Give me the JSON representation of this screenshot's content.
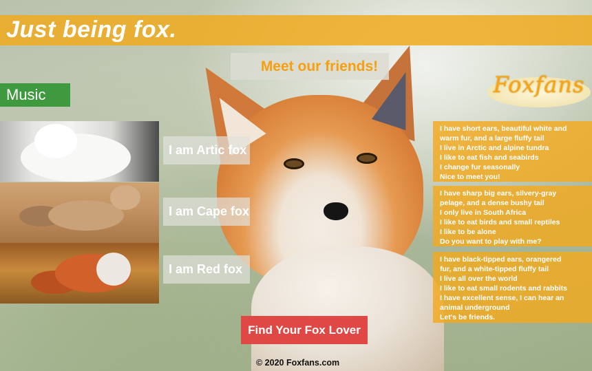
{
  "header": {
    "title": "Just being fox."
  },
  "meet_label": "Meet our friends!",
  "music_label": "Music",
  "logo": {
    "text": "Foxfans"
  },
  "friends": [
    {
      "button_label": "I am Artic fox",
      "description": [
        "I have short ears, beautiful white and",
        "warm fur, and a large fluffy tail",
        "I live in Arctic and alpine tundra",
        "I like to eat fish and seabirds",
        "I change fur seasonally",
        "Nice to meet you!"
      ]
    },
    {
      "button_label": "I am Cape fox",
      "description": [
        "I have sharp big ears, silvery-gray",
        "pelage, and a dense bushy tail",
        "I only live in South Africa",
        "I like to eat birds and small reptiles",
        "I like to be alone",
        "Do you want to play with me?"
      ]
    },
    {
      "button_label": "I am Red fox",
      "description": [
        "I have black-tipped ears, orangered",
        "fur, and a white-tipped fluffy tail",
        "I live all over the world",
        "I like to eat small rodents and rabbits",
        "I have excellent sense, I can hear an",
        "animal underground",
        "Let's be friends."
      ]
    }
  ],
  "find_button_label": "Find Your Fox Lover",
  "footer_text": "© 2020 Foxfans.com",
  "colors": {
    "header_bar": "#f0aa1e",
    "accent_orange": "#f4a010",
    "music_green": "#3f9a3f",
    "find_button_red": "#e04846",
    "card_orange": "#f3aa1e"
  },
  "icons": [
    "fox-hero-image",
    "artic-fox-photo",
    "cape-fox-photo",
    "red-fox-photo",
    "foxfans-logo"
  ]
}
